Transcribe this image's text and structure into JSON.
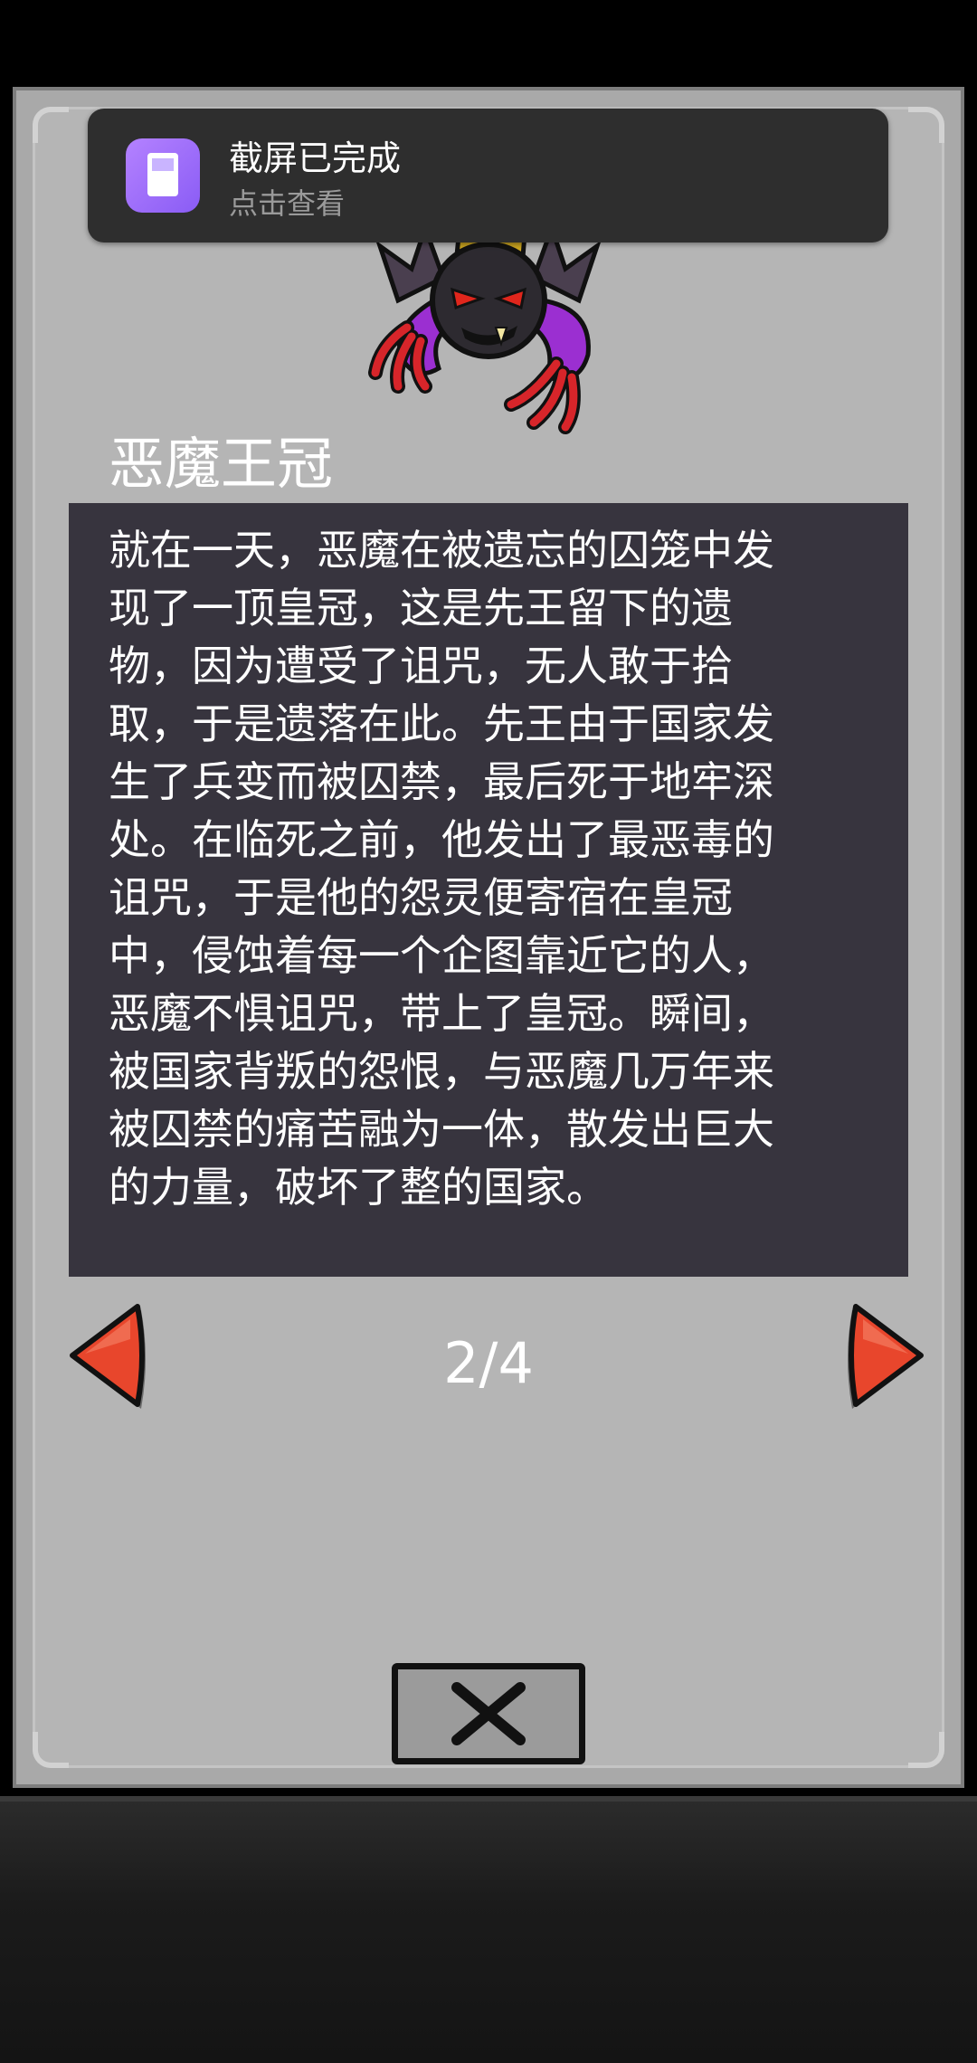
{
  "notification": {
    "title": "截屏已完成",
    "subtitle": "点击查看",
    "icon": "screenshot-icon",
    "icon_color": "#9b6cf8"
  },
  "item": {
    "title": "恶魔王冠",
    "portrait": "demon-crown-character",
    "description": "就在一天，恶魔在被遗忘的囚笼中发\n现了一顶皇冠，这是先王留下的遗\n物，因为遭受了诅咒，无人敢于拾\n取，于是遗落在此。先王由于国家发\n生了兵变而被囚禁，最后死于地牢深\n处。在临死之前，他发出了最恶毒的\n诅咒，于是他的怨灵便寄宿在皇冠\n中，侵蚀着每一个企图靠近它的人，\n恶魔不惧诅咒，带上了皇冠。瞬间，\n被国家背叛的怨恨，与恶魔几万年来\n被囚禁的痛苦融为一体，散发出巨大\n的力量，破坏了整的国家。"
  },
  "pager": {
    "label": "2/4",
    "prev_icon": "left-arrow-icon",
    "next_icon": "right-arrow-icon"
  },
  "close": {
    "icon": "close-x-icon"
  },
  "colors": {
    "panel": "#b5b5b5",
    "desc_box": "#37343e",
    "arrow_red": "#e8462c"
  }
}
